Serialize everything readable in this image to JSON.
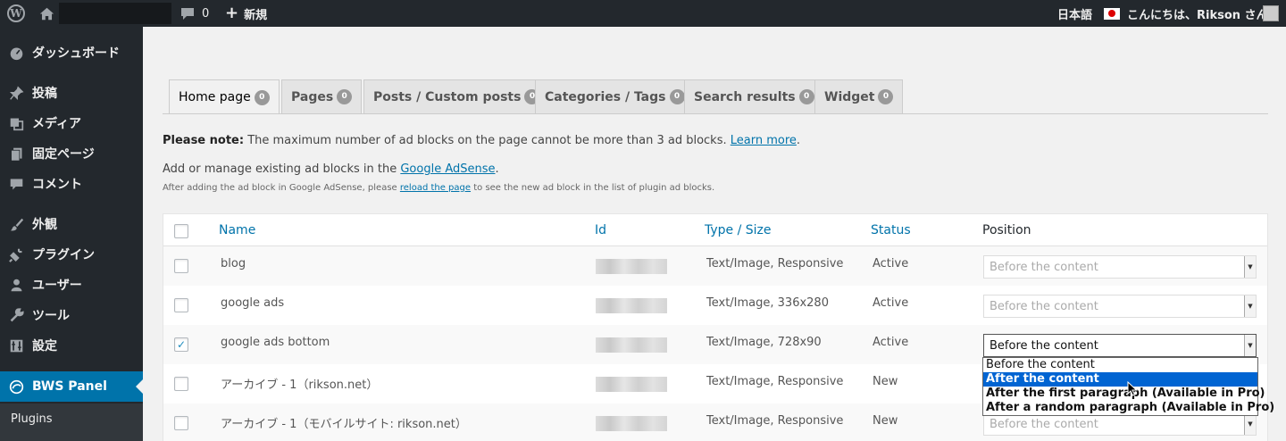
{
  "adminbar": {
    "comments_count": "0",
    "new_label": "新規",
    "language": "日本語",
    "howdy": "こんにちは、Rikson さん"
  },
  "sidebar": {
    "items": [
      {
        "label": "ダッシュボード",
        "icon": "dashboard-icon"
      },
      {
        "label": "投稿",
        "icon": "pin-icon"
      },
      {
        "label": "メディア",
        "icon": "media-icon"
      },
      {
        "label": "固定ページ",
        "icon": "page-icon"
      },
      {
        "label": "コメント",
        "icon": "comment-icon"
      },
      {
        "label": "外観",
        "icon": "brush-icon"
      },
      {
        "label": "プラグイン",
        "icon": "plug-icon"
      },
      {
        "label": "ユーザー",
        "icon": "user-icon"
      },
      {
        "label": "ツール",
        "icon": "wrench-icon"
      },
      {
        "label": "設定",
        "icon": "settings-icon"
      },
      {
        "label": "BWS Panel",
        "icon": "bws-icon"
      }
    ],
    "sub_items": [
      "Plugins"
    ]
  },
  "tabs": [
    {
      "label": "Home page",
      "count": "0"
    },
    {
      "label": "Pages",
      "count": "0"
    },
    {
      "label": "Posts / Custom posts",
      "count": "0"
    },
    {
      "label": "Categories / Tags",
      "count": "0"
    },
    {
      "label": "Search results",
      "count": "0"
    },
    {
      "label": "Widget",
      "count": "0"
    }
  ],
  "notes": {
    "note_bold": "Please note:",
    "note_text": " The maximum number of ad blocks on the page cannot be more than 3 ad blocks. ",
    "learn_more": "Learn more",
    "period": ".",
    "add_text": "Add or manage existing ad blocks in the ",
    "adsense_link": "Google AdSense",
    "small_before": "After adding the ad block in Google AdSense, please ",
    "small_link": "reload the page",
    "small_after": " to see the new ad block in the list of plugin ad blocks."
  },
  "table": {
    "headers": {
      "name": "Name",
      "id": "Id",
      "type": "Type / Size",
      "status": "Status",
      "position": "Position"
    },
    "rows": [
      {
        "name": "blog",
        "type": "Text/Image, Responsive",
        "status": "Active",
        "position": "Before the content",
        "checked": false
      },
      {
        "name": "google ads",
        "type": "Text/Image, 336x280",
        "status": "Active",
        "position": "Before the content",
        "checked": false
      },
      {
        "name": "google ads bottom",
        "type": "Text/Image, 728x90",
        "status": "Active",
        "position": "Before the content",
        "checked": true
      },
      {
        "name": "アーカイブ - 1（rikson.net）",
        "type": "Text/Image, Responsive",
        "status": "New",
        "position": "",
        "checked": false
      },
      {
        "name": "アーカイブ - 1（モバイルサイト: rikson.net）",
        "type": "Text/Image, Responsive",
        "status": "New",
        "position": "Before the content",
        "checked": false
      }
    ]
  },
  "dropdown": {
    "options": [
      "Before the content",
      "After the content",
      "After the first paragraph (Available in Pro)",
      "After a random paragraph (Available in Pro)"
    ]
  }
}
